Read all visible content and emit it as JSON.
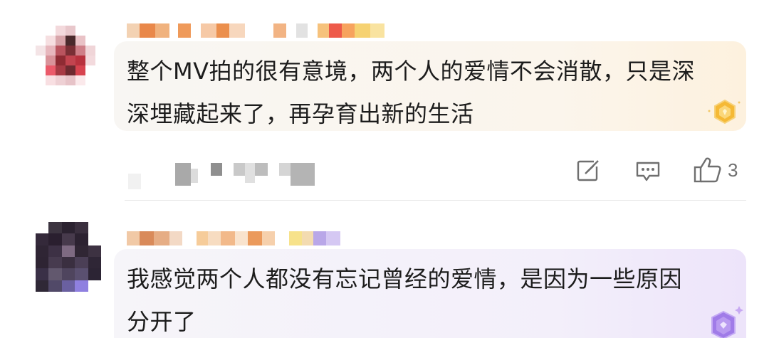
{
  "comments": [
    {
      "text": "整个MV拍的很有意境，两个人的爱情不会消散，只是深深埋藏起来了，再孕育出新的生活",
      "badge_color": "#f5b935",
      "like_count": "3",
      "actions": {
        "share_icon": "share-edit-icon",
        "reply_icon": "comment-icon",
        "like_icon": "thumbs-up-icon"
      }
    },
    {
      "text": "我感觉两个人都没有忘记曾经的爱情，是因为一些原因分开了",
      "badge_color": "#a07be8"
    }
  ]
}
